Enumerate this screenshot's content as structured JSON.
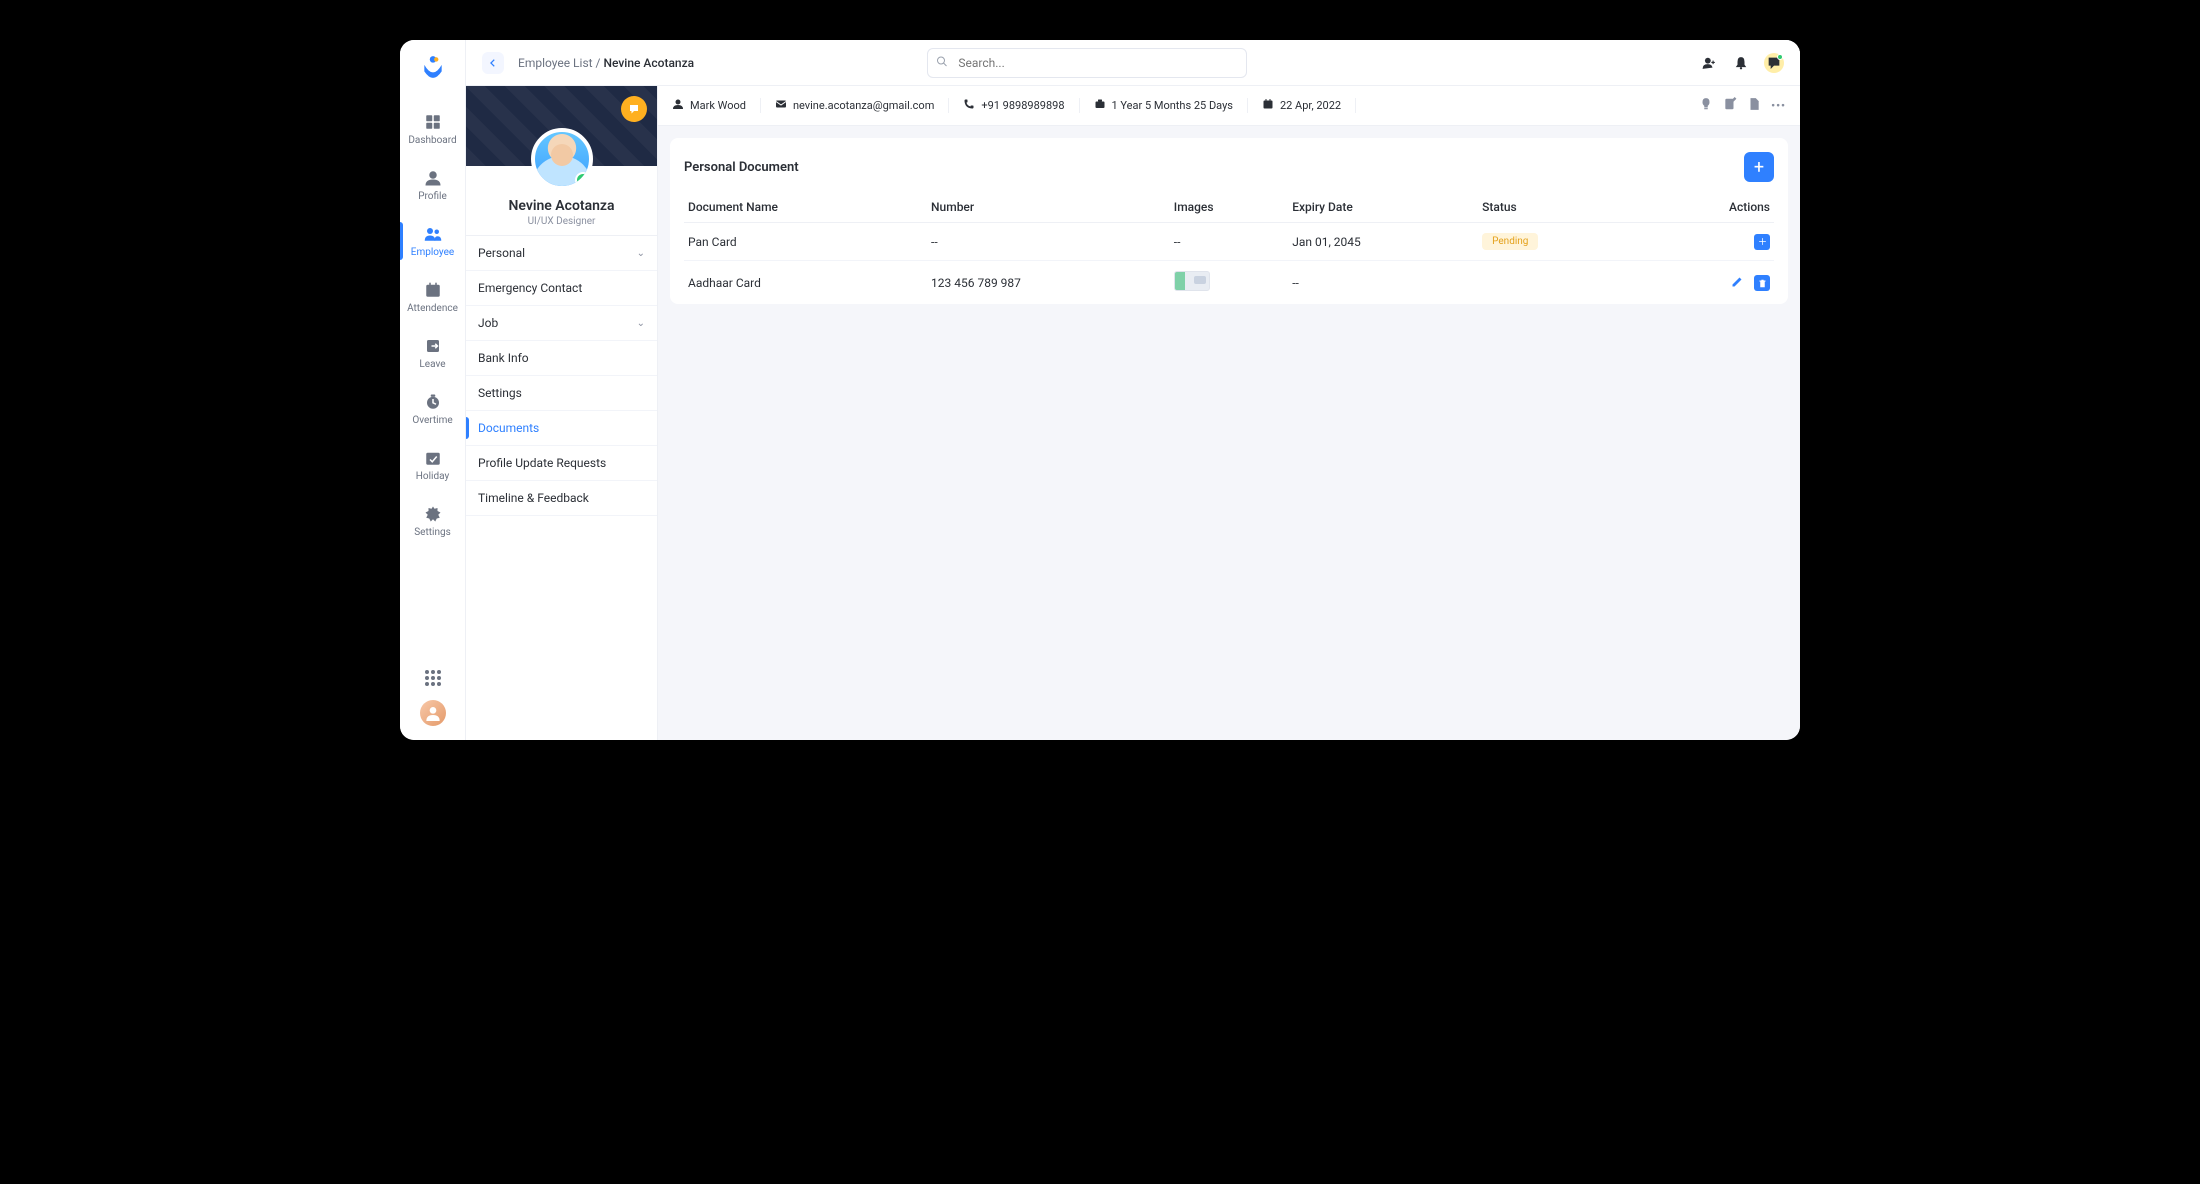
{
  "search": {
    "placeholder": "Search..."
  },
  "breadcrumb": {
    "root": "Employee List",
    "current": "Nevine Acotanza",
    "sep": " / "
  },
  "sidebar": {
    "items": [
      {
        "label": "Dashboard"
      },
      {
        "label": "Profile"
      },
      {
        "label": "Employee"
      },
      {
        "label": "Attendence"
      },
      {
        "label": "Leave"
      },
      {
        "label": "Overtime"
      },
      {
        "label": "Holiday"
      },
      {
        "label": "Settings"
      }
    ]
  },
  "profile": {
    "name": "Nevine Acotanza",
    "role": "UI/UX Designer"
  },
  "sub_nav": {
    "personal": "Personal",
    "emergency": "Emergency Contact",
    "job": "Job",
    "bank": "Bank Info",
    "settings": "Settings",
    "documents": "Documents",
    "profile_update": "Profile Update Requests",
    "timeline": "Timeline & Feedback"
  },
  "info_strip": {
    "manager": "Mark Wood",
    "email": "nevine.acotanza@gmail.com",
    "phone": "+91 9898989898",
    "tenure": "1 Year 5 Months 25 Days",
    "date": "22 Apr, 2022"
  },
  "card": {
    "title": "Personal Document"
  },
  "table": {
    "headers": {
      "name": "Document Name",
      "number": "Number",
      "images": "Images",
      "expiry": "Expiry Date",
      "status": "Status",
      "actions": "Actions"
    },
    "rows": [
      {
        "name": "Pan Card",
        "number": "--",
        "images": "--",
        "expiry": "Jan 01, 2045",
        "status": "Pending",
        "has_image": false,
        "actions": "plus"
      },
      {
        "name": "Aadhaar Card",
        "number": "123 456 789 987",
        "images": "",
        "expiry": "--",
        "status": "",
        "has_image": true,
        "actions": "edit-del"
      }
    ]
  }
}
